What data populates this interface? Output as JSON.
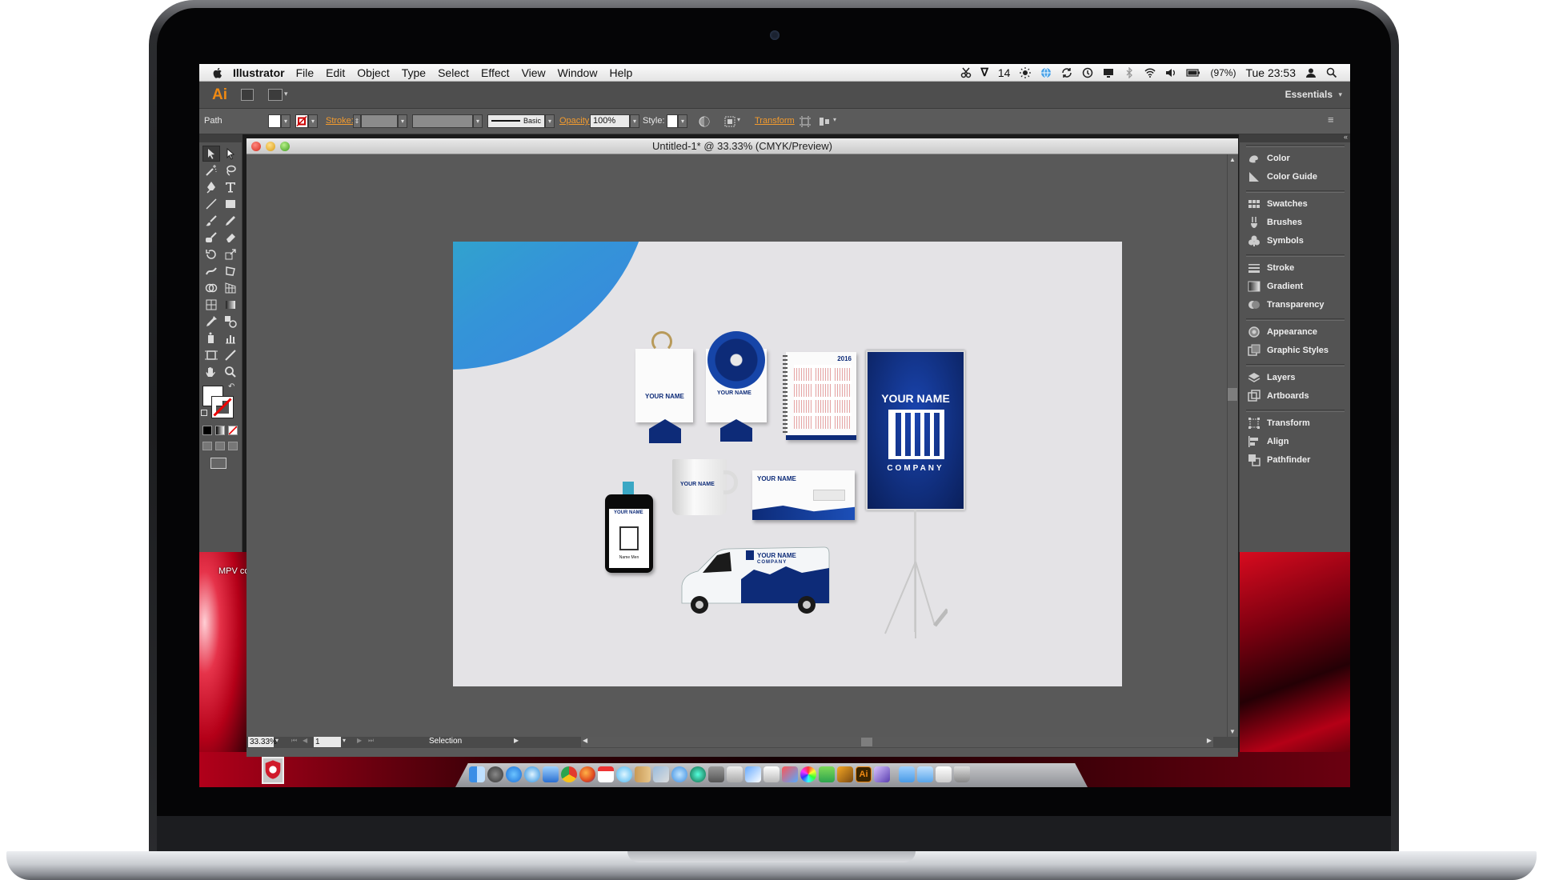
{
  "menubar": {
    "app_name": "Illustrator",
    "menus": [
      "File",
      "Edit",
      "Object",
      "Type",
      "Select",
      "Effect",
      "View",
      "Window",
      "Help"
    ],
    "adobe_count": "14",
    "battery": "(97%)",
    "clock": "Tue 23:53"
  },
  "appbar": {
    "logo": "Ai",
    "workspace": "Essentials"
  },
  "controlbar": {
    "selection_type": "Path",
    "stroke_label": "Stroke:",
    "brush_label": "Basic",
    "opacity_label": "Opacity:",
    "opacity_value": "100%",
    "style_label": "Style:",
    "transform_label": "Transform"
  },
  "document": {
    "title": "Untitled-1* @ 33.33% (CMYK/Preview)",
    "zoom": "33.33%",
    "artboard_number": "1",
    "status": "Selection"
  },
  "artboard": {
    "brand_line1": "YOUR NAME",
    "brand_line2": "COMPANY",
    "calendar_year": "2016",
    "badge_name": "Name Men"
  },
  "desktop": {
    "file_label": "MPV co"
  },
  "panels": [
    {
      "label": "Color",
      "icon": "color-icon"
    },
    {
      "label": "Color Guide",
      "icon": "color-guide-icon"
    },
    {
      "label": "Swatches",
      "icon": "swatches-icon"
    },
    {
      "label": "Brushes",
      "icon": "brushes-icon"
    },
    {
      "label": "Symbols",
      "icon": "symbols-icon"
    },
    {
      "label": "Stroke",
      "icon": "stroke-icon"
    },
    {
      "label": "Gradient",
      "icon": "gradient-icon"
    },
    {
      "label": "Transparency",
      "icon": "transparency-icon"
    },
    {
      "label": "Appearance",
      "icon": "appearance-icon"
    },
    {
      "label": "Graphic Styles",
      "icon": "graphic-styles-icon"
    },
    {
      "label": "Layers",
      "icon": "layers-icon"
    },
    {
      "label": "Artboards",
      "icon": "artboards-icon"
    },
    {
      "label": "Transform",
      "icon": "transform-icon"
    },
    {
      "label": "Align",
      "icon": "align-icon"
    },
    {
      "label": "Pathfinder",
      "icon": "pathfinder-icon"
    }
  ],
  "colors": {
    "ai_orange": "#f08a13",
    "brand_blue": "#0d2b78",
    "gradient_teal": "#1bd1a4",
    "gradient_blue": "#3a84e0"
  }
}
